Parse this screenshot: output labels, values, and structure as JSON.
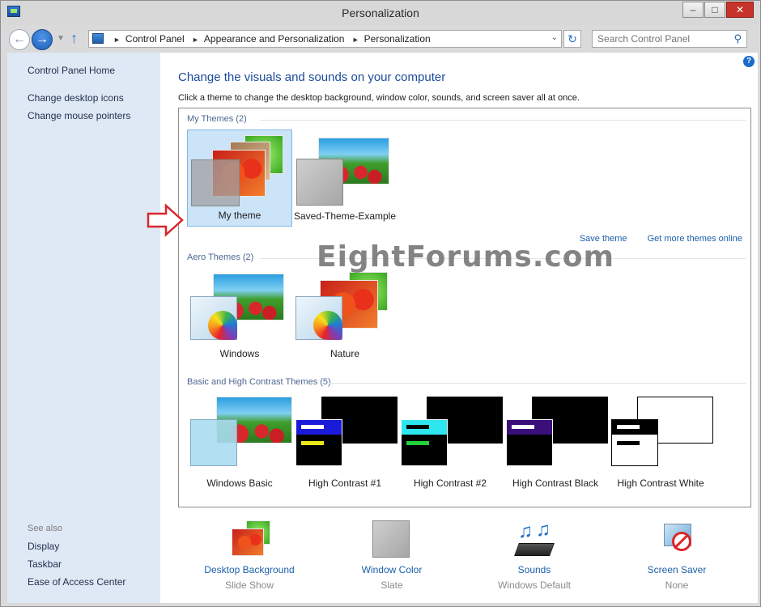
{
  "window": {
    "title": "Personalization",
    "minimize": "–",
    "maximize": "□",
    "close": "✕"
  },
  "navigation": {
    "back_icon": "←",
    "forward_icon": "→",
    "up_icon": "↑",
    "refresh_icon": "↻",
    "breadcrumbs": [
      "Control Panel",
      "Appearance and Personalization",
      "Personalization"
    ],
    "search_placeholder": "Search Control Panel"
  },
  "sidebar": {
    "home": "Control Panel Home",
    "links": [
      "Change desktop icons",
      "Change mouse pointers"
    ],
    "see_also_heading": "See also",
    "see_also": [
      "Display",
      "Taskbar",
      "Ease of Access Center"
    ]
  },
  "main": {
    "title": "Change the visuals and sounds on your computer",
    "description": "Click a theme to change the desktop background, window color, sounds, and screen saver all at once.",
    "help_icon": "?"
  },
  "themes": {
    "my_themes_label": "My Themes (2)",
    "my_themes": [
      "My theme",
      "Saved-Theme-Example"
    ],
    "save_theme": "Save theme",
    "get_more": "Get more themes online",
    "aero_label": "Aero Themes (2)",
    "aero_themes": [
      "Windows",
      "Nature"
    ],
    "basic_label": "Basic and High Contrast Themes (5)",
    "basic_themes": [
      "Windows Basic",
      "High Contrast #1",
      "High Contrast #2",
      "High Contrast Black",
      "High Contrast White"
    ]
  },
  "watermark": "EightForums.com",
  "settings": [
    {
      "label": "Desktop Background",
      "value": "Slide Show"
    },
    {
      "label": "Window Color",
      "value": "Slate"
    },
    {
      "label": "Sounds",
      "value": "Windows Default"
    },
    {
      "label": "Screen Saver",
      "value": "None"
    }
  ],
  "colors": {
    "accent": "#1b4b9b",
    "selected_bg": "#cbe4f8",
    "sidebar_bg": "#dfe8f5",
    "annotation_arrow": "#d9262c"
  }
}
